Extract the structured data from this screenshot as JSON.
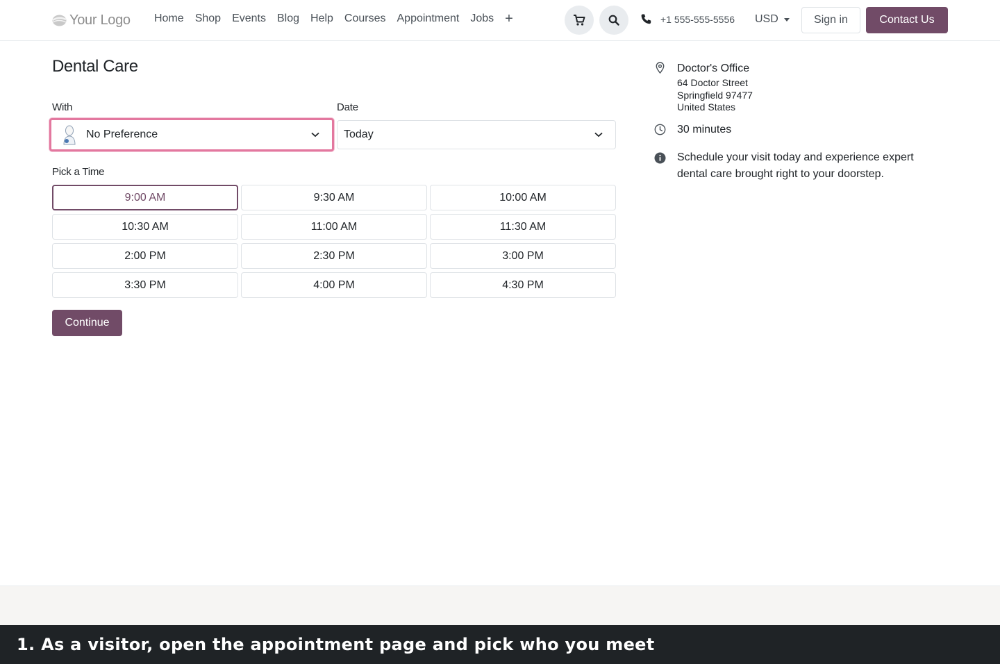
{
  "header": {
    "logo_text": "Your Logo",
    "nav": [
      "Home",
      "Shop",
      "Events",
      "Blog",
      "Help",
      "Courses",
      "Appointment",
      "Jobs"
    ],
    "plus_glyph": "+",
    "cart_icon": "cart-icon",
    "search_icon": "search-icon",
    "phone": "+1 555-555-5556",
    "currency": "USD",
    "signin_label": "Sign in",
    "contact_label": "Contact Us",
    "brand_color": "#714b67"
  },
  "appointment": {
    "title": "Dental Care",
    "with_label": "With",
    "with_value": "No Preference",
    "date_label": "Date",
    "date_value": "Today",
    "pick_time_label": "Pick a Time",
    "slots": [
      "9:00 AM",
      "9:30 AM",
      "10:00 AM",
      "10:30 AM",
      "11:00 AM",
      "11:30 AM",
      "2:00 PM",
      "2:30 PM",
      "3:00 PM",
      "3:30 PM",
      "4:00 PM",
      "4:30 PM"
    ],
    "selected_slot": "9:00 AM",
    "continue_label": "Continue"
  },
  "details": {
    "location_name": "Doctor's Office",
    "address": [
      "64 Doctor Street",
      "Springfield 97477",
      "United States"
    ],
    "duration": "30 minutes",
    "description_line1": "Schedule your visit today and experience expert",
    "description_line2": "dental care brought right to your doorstep."
  },
  "caption": "1. As a visitor, open the appointment page and pick who you meet"
}
